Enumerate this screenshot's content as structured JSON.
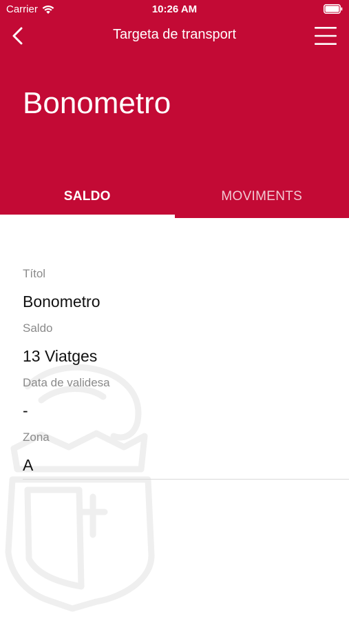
{
  "status_bar": {
    "carrier": "Carrier",
    "time": "10:26 AM"
  },
  "nav": {
    "title": "Targeta de transport",
    "back_icon": "chevron-left-icon",
    "menu_icon": "hamburger-menu-icon"
  },
  "header": {
    "title": "Bonometro"
  },
  "tabs": [
    {
      "label": "SALDO",
      "active": true
    },
    {
      "label": "MOVIMENTS",
      "active": false
    }
  ],
  "fields": [
    {
      "label": "Títol",
      "value": "Bonometro"
    },
    {
      "label": "Saldo",
      "value": "13 Viatges"
    },
    {
      "label": "Data de validesa",
      "value": "-"
    },
    {
      "label": "Zona",
      "value": "A"
    }
  ],
  "colors": {
    "brand": "#c30a35",
    "label_text": "#8a8a8a",
    "value_text": "#111111",
    "watermark": "#f2f2f2"
  }
}
